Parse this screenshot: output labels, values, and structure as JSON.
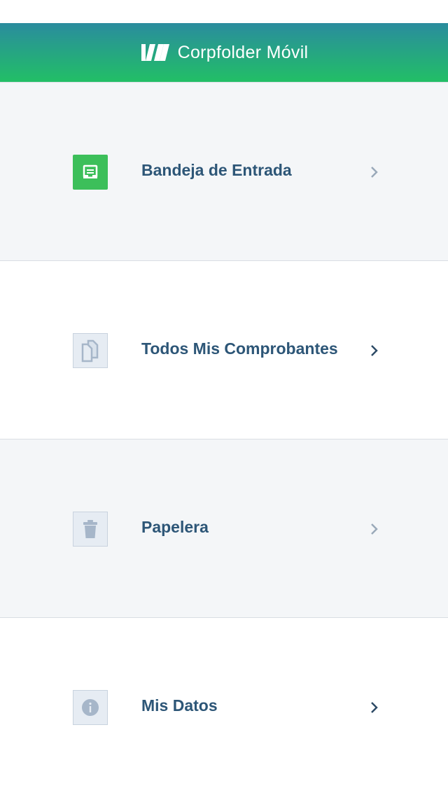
{
  "header": {
    "title": "Corpfolder Móvil",
    "logo_icon": "corpfolder-logo-icon"
  },
  "colors": {
    "header_gradient_top": "#2a8c9e",
    "header_gradient_bottom": "#22bf66",
    "accent_green": "#3cbf5a",
    "label_text": "#2d5677",
    "row_shaded": "#f4f6f8",
    "icon_muted": "#a6b6c9"
  },
  "menu": {
    "items": [
      {
        "label": "Bandeja de Entrada",
        "icon": "inbox-icon"
      },
      {
        "label": "Todos Mis Comprobantes",
        "icon": "documents-icon"
      },
      {
        "label": "Papelera",
        "icon": "trash-icon"
      },
      {
        "label": "Mis Datos",
        "icon": "info-icon"
      }
    ]
  }
}
